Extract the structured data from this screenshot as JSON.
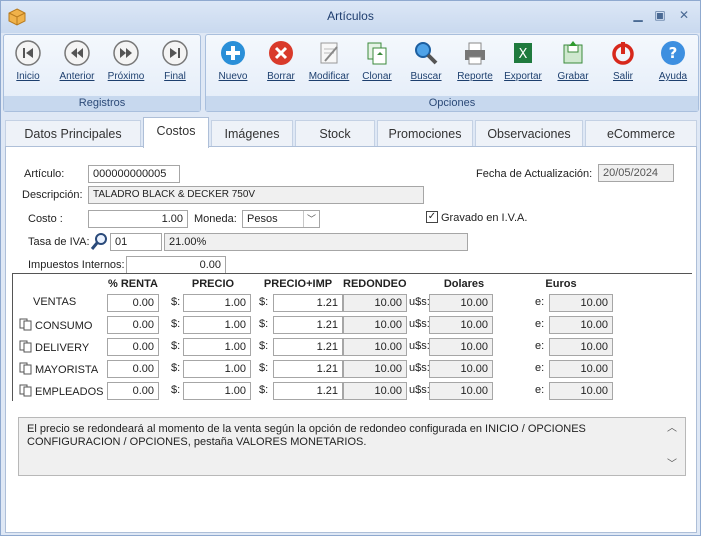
{
  "window": {
    "title": "Artículos"
  },
  "ribbon": {
    "registros": {
      "label": "Registros",
      "buttons": [
        {
          "id": "inicio",
          "label": "Inicio",
          "icon": "first-icon"
        },
        {
          "id": "anterior",
          "label": "Anterior",
          "icon": "previous-icon"
        },
        {
          "id": "proximo",
          "label": "Próximo",
          "icon": "next-icon"
        },
        {
          "id": "final",
          "label": "Final",
          "icon": "last-icon"
        }
      ]
    },
    "opciones": {
      "label": "Opciones",
      "buttons": [
        {
          "id": "nuevo",
          "label": "Nuevo",
          "icon": "add-icon"
        },
        {
          "id": "borrar",
          "label": "Borrar",
          "icon": "delete-icon"
        },
        {
          "id": "modificar",
          "label": "Modificar",
          "icon": "edit-icon"
        },
        {
          "id": "clonar",
          "label": "Clonar",
          "icon": "clone-icon"
        },
        {
          "id": "buscar",
          "label": "Buscar",
          "icon": "search-icon"
        },
        {
          "id": "reporte",
          "label": "Reporte",
          "icon": "printer-icon"
        },
        {
          "id": "exportar",
          "label": "Exportar",
          "icon": "excel-icon"
        },
        {
          "id": "grabar",
          "label": "Grabar",
          "icon": "save-icon"
        },
        {
          "id": "salir",
          "label": "Salir",
          "icon": "power-icon"
        },
        {
          "id": "ayuda",
          "label": "Ayuda",
          "icon": "help-icon"
        }
      ]
    }
  },
  "tabs": [
    "Datos Principales",
    "Costos",
    "Imágenes",
    "Stock",
    "Promociones",
    "Observaciones",
    "eCommerce"
  ],
  "active_tab": "Costos",
  "form": {
    "articulo_label": "Artículo:",
    "articulo": "000000000005",
    "fecha_label": "Fecha de Actualización:",
    "fecha": "20/05/2024",
    "descripcion_label": "Descripción:",
    "descripcion": "TALADRO BLACK & DECKER 750V",
    "costo_label": "Costo :",
    "costo": "1.00",
    "moneda_label": "Moneda:",
    "moneda": "Pesos",
    "gravado_label": "Gravado en I.V.A.",
    "gravado_checked": true,
    "iva_label": "Tasa de IVA:",
    "iva_code": "01",
    "iva_rate": "21.00%",
    "impuestos_label": "Impuestos Internos:",
    "impuestos": "0.00"
  },
  "price_table": {
    "headers": [
      "% RENTA",
      "PRECIO",
      "PRECIO+IMP",
      "REDONDEO",
      "Dolares",
      "Euros"
    ],
    "currency_peso": "$:",
    "currency_usd": "u$s:",
    "currency_eur": "e:",
    "rows": [
      {
        "name": "VENTAS",
        "icon": false,
        "renta": "0.00",
        "precio": "1.00",
        "precio_imp": "1.21",
        "redondeo": "10.00",
        "dolares": "10.00",
        "euros": "10.00"
      },
      {
        "name": "CONSUMO",
        "icon": true,
        "renta": "0.00",
        "precio": "1.00",
        "precio_imp": "1.21",
        "redondeo": "10.00",
        "dolares": "10.00",
        "euros": "10.00"
      },
      {
        "name": "DELIVERY",
        "icon": true,
        "renta": "0.00",
        "precio": "1.00",
        "precio_imp": "1.21",
        "redondeo": "10.00",
        "dolares": "10.00",
        "euros": "10.00"
      },
      {
        "name": "MAYORISTA",
        "icon": true,
        "renta": "0.00",
        "precio": "1.00",
        "precio_imp": "1.21",
        "redondeo": "10.00",
        "dolares": "10.00",
        "euros": "10.00"
      },
      {
        "name": "EMPLEADOS",
        "icon": true,
        "renta": "0.00",
        "precio": "1.00",
        "precio_imp": "1.21",
        "redondeo": "10.00",
        "dolares": "10.00",
        "euros": "10.00"
      }
    ]
  },
  "note": "El precio se redondeará al momento de la venta según la opción de redondeo configurada en INICIO / OPCIONES CONFIGURACION / OPCIONES, pestaña VALORES MONETARIOS."
}
